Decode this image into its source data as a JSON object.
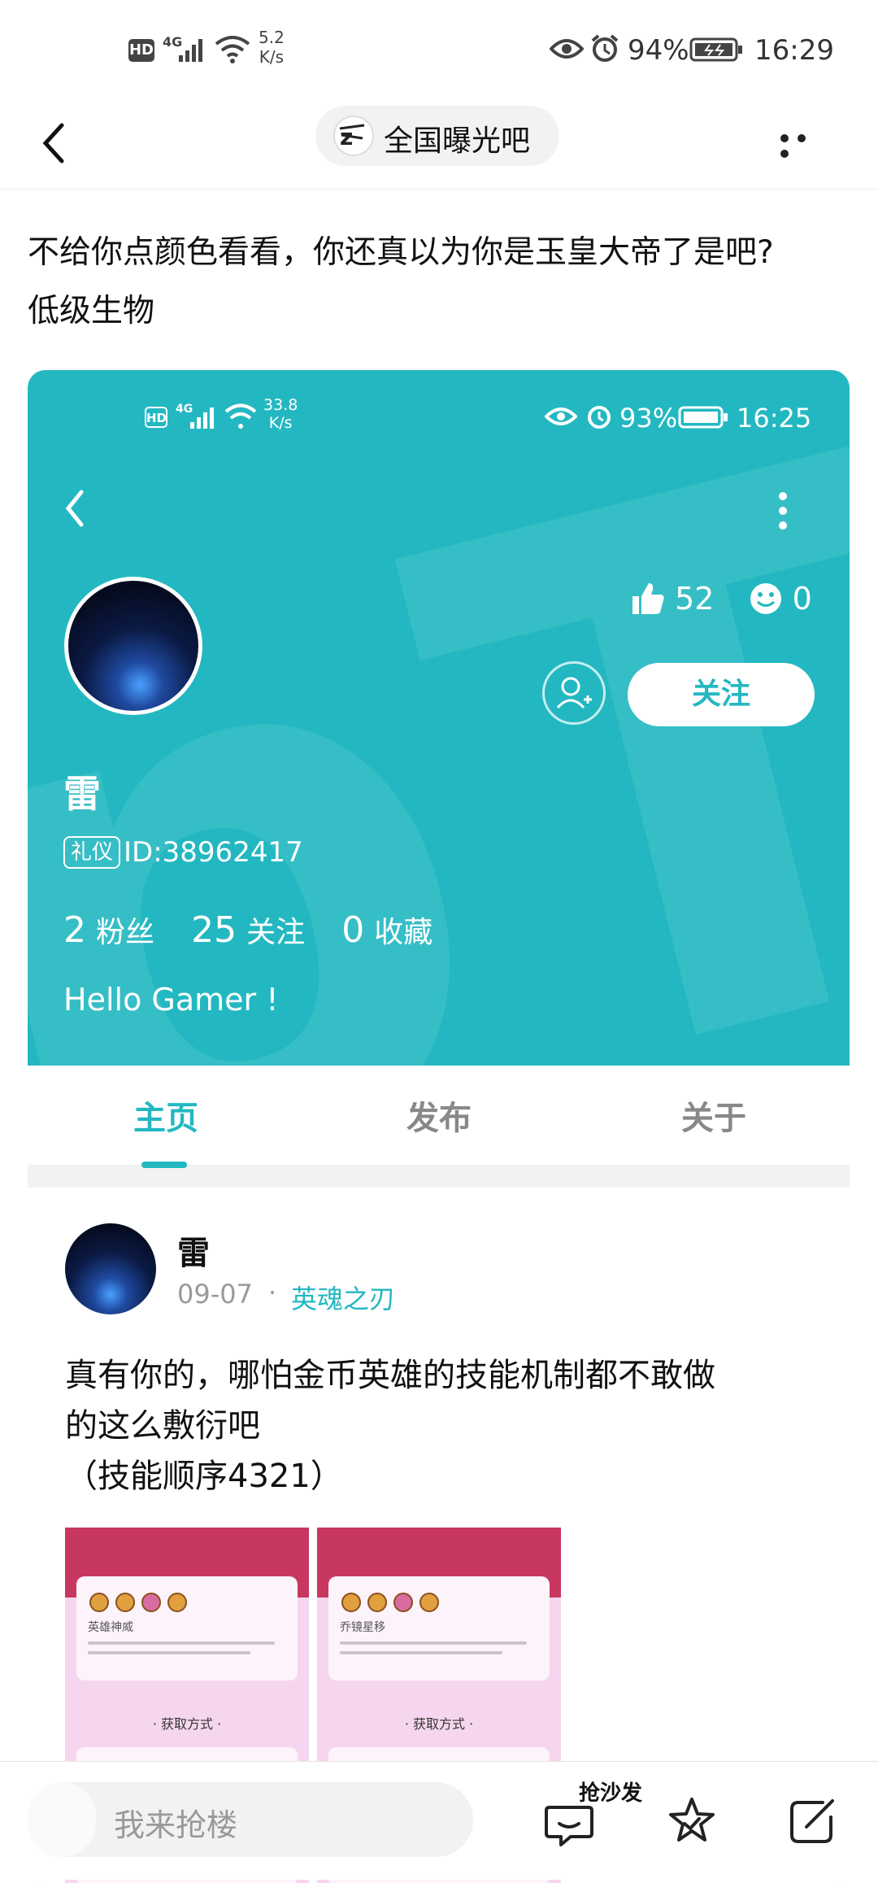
{
  "status_bar": {
    "hd": "HD",
    "net": "4G",
    "speed_value": "5.2",
    "speed_unit": "K/s",
    "battery_pct": "94%",
    "time": "16:29"
  },
  "header": {
    "title": "全国曝光吧"
  },
  "post": {
    "text_line1": "不给你点颜色看看，你还真以为你是玉皇大帝了是吧?",
    "text_line2": "低级生物"
  },
  "embedded": {
    "status": {
      "hd": "HD",
      "net": "4G",
      "speed_value": "33.8",
      "speed_unit": "K/s",
      "battery_pct": "93%",
      "time": "16:25"
    },
    "profile": {
      "name": "雷",
      "badge": "礼仪",
      "id_text": "ID:38962417",
      "likes": "52",
      "smiles": "0",
      "follow_label": "关注",
      "fans_count": "2",
      "fans_label": "粉丝",
      "following_count": "25",
      "following_label": "关注",
      "favorites_count": "0",
      "favorites_label": "收藏",
      "bio": "Hello Gamer !"
    },
    "tabs": [
      "主页",
      "发布",
      "关于"
    ],
    "active_tab": 0,
    "feed_item": {
      "author": "雷",
      "date": "09-07",
      "separator": "·",
      "game": "英魂之刃",
      "body_line1": "真有你的，哪怕金币英雄的技能机制都不敢做",
      "body_line2": "的这么敷衍吧",
      "body_line3": "（技能顺序4321）",
      "thumbs": [
        {
          "title": "英雄神威",
          "get": "· 获取方式 ·"
        },
        {
          "title": "乔镜星移",
          "get": "· 获取方式 ·"
        }
      ]
    }
  },
  "bottom_bar": {
    "input_placeholder": "我来抢楼",
    "sofa_label": "抢沙发",
    "icons": [
      "comment-icon",
      "star-icon",
      "share-icon"
    ]
  },
  "colors": {
    "accent_teal": "#23b8c1"
  }
}
